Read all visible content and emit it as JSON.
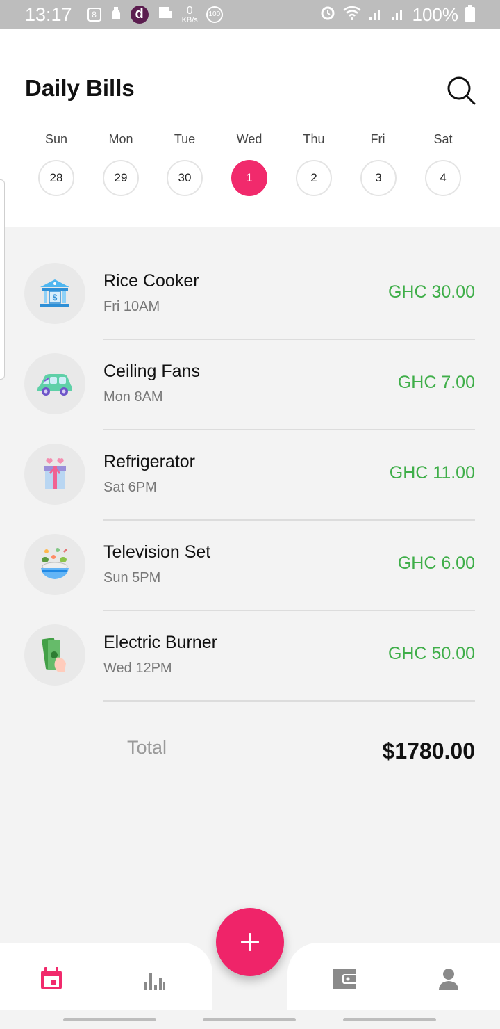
{
  "status_bar": {
    "time": "13:17",
    "battery": "100%",
    "net_speed": "0",
    "net_unit": "KB/s",
    "badge_count": "100"
  },
  "header": {
    "title": "Daily Bills"
  },
  "week": {
    "days": [
      {
        "label": "Sun",
        "date": "28"
      },
      {
        "label": "Mon",
        "date": "29"
      },
      {
        "label": "Tue",
        "date": "30"
      },
      {
        "label": "Wed",
        "date": "1",
        "selected": true
      },
      {
        "label": "Thu",
        "date": "2"
      },
      {
        "label": "Fri",
        "date": "3"
      },
      {
        "label": "Sat",
        "date": "4"
      }
    ]
  },
  "bills": [
    {
      "name": "Rice Cooker",
      "time": "Fri 10AM",
      "amount": "GHC 30.00",
      "icon": "bank-icon"
    },
    {
      "name": "Ceiling Fans",
      "time": "Mon 8AM",
      "amount": "GHC 7.00",
      "icon": "car-icon"
    },
    {
      "name": "Refrigerator",
      "time": "Sat 6PM",
      "amount": "GHC 11.00",
      "icon": "gift-icon"
    },
    {
      "name": "Television Set",
      "time": "Sun 5PM",
      "amount": "GHC 6.00",
      "icon": "food-bowl-icon"
    },
    {
      "name": "Electric Burner",
      "time": "Wed 12PM",
      "amount": "GHC 50.00",
      "icon": "cash-hand-icon"
    }
  ],
  "summary": {
    "total_label": "Total",
    "total_value": "$1780.00"
  },
  "colors": {
    "accent": "#f12a6c",
    "amount_green": "#3fae49",
    "nav_inactive": "#8a8a8a"
  },
  "bottom_nav": [
    "calendar-icon",
    "bar-chart-icon",
    "add-icon",
    "wallet-icon",
    "profile-icon"
  ]
}
